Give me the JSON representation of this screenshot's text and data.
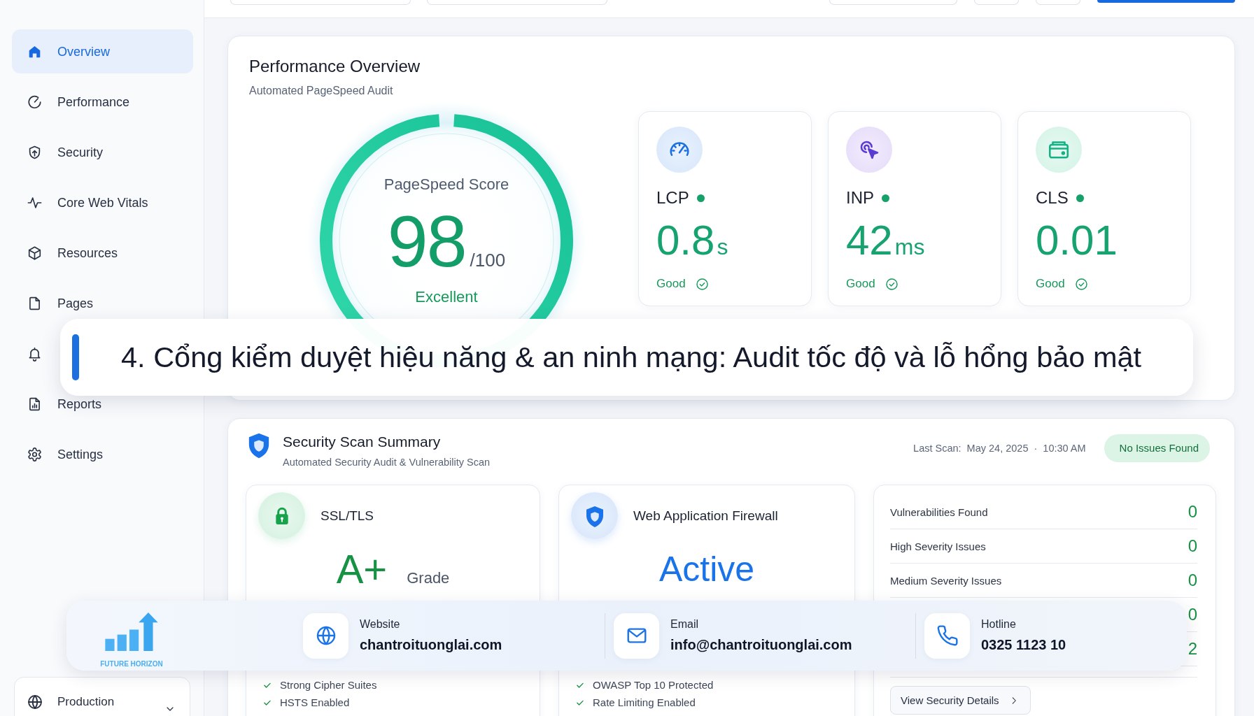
{
  "header": {
    "left": [
      {
        "kind": "field"
      },
      {
        "kind": "field"
      }
    ],
    "right": [
      {
        "kind": "button"
      },
      {
        "kind": "icon_button"
      },
      {
        "kind": "icon_button"
      },
      {
        "kind": "primary_button"
      }
    ]
  },
  "sidebar": {
    "nav": [
      {
        "label": "Overview",
        "selected": true
      },
      {
        "label": "Performance",
        "selected": false
      },
      {
        "label": "Security",
        "selected": false
      },
      {
        "label": "Core Web Vitals",
        "selected": false
      },
      {
        "label": "Resources",
        "selected": false
      },
      {
        "label": "Pages",
        "selected": false
      },
      {
        "selected": false
      },
      {
        "label": "Reports",
        "selected": false
      },
      {
        "label": "Settings",
        "selected": false
      }
    ],
    "environment": {
      "label": "Production"
    }
  },
  "performance": {
    "title": "Performance Overview",
    "subtitle": "Automated PageSpeed Audit",
    "score": {
      "label": "PageSpeed Score",
      "value": "98",
      "max": "/100",
      "rating": "Excellent",
      "level": 0.98
    },
    "metrics": [
      {
        "name": "LCP",
        "value": "0.8",
        "unit": "s",
        "status": "Good"
      },
      {
        "name": "INP",
        "value": "42",
        "unit": "ms",
        "status": "Good"
      },
      {
        "name": "CLS",
        "value": "0.01",
        "status": "Good"
      }
    ]
  },
  "caption": {
    "text": "4. Cổng kiểm duyệt hiệu năng & an ninh mạng: Audit tốc độ và lỗ hổng bảo mật"
  },
  "security": {
    "title": "Security Scan Summary",
    "subtitle": "Automated Security Audit & Vulnerability Scan",
    "last_scan": {
      "label": "Last Scan:",
      "date": "May 24, 2025",
      "separator": "·",
      "time": "10:30 AM"
    },
    "status_badge": "No Issues Found",
    "cards": [
      {
        "kind": "grade",
        "title": "SSL/TLS",
        "value": "A+",
        "value_note": "Grade",
        "checks": [
          "Strong Cipher Suites",
          "HSTS Enabled"
        ]
      },
      {
        "kind": "status",
        "title": "Web Application Firewall",
        "value": "Active",
        "checks": [
          "OWASP Top 10 Protected",
          "Rate Limiting Enabled"
        ]
      }
    ],
    "stats": [
      {
        "label": "Vulnerabilities Found",
        "value": "0"
      },
      {
        "label": "High Severity Issues",
        "value": "0"
      },
      {
        "label": "Medium Severity Issues",
        "value": "0"
      },
      {
        "value": "0"
      },
      {
        "value": "2"
      }
    ],
    "details_button": "View Security Details"
  },
  "contact_bar": {
    "logo_text": "FUTURE HORIZON",
    "items": [
      {
        "label": "Website",
        "value": "chantroituonglai.com"
      },
      {
        "label": "Email",
        "value": "info@chantroituonglai.com"
      },
      {
        "label": "Hotline",
        "value": "0325 1123 10"
      }
    ]
  }
}
